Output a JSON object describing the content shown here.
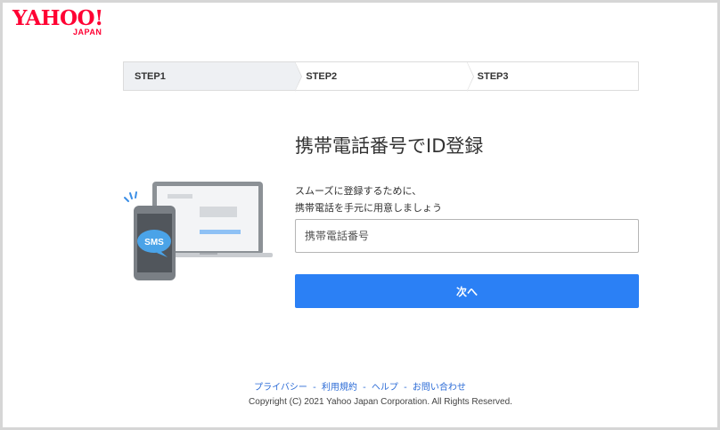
{
  "logo": {
    "main": "YAHOO!",
    "sub": "JAPAN"
  },
  "steps": [
    {
      "label": "STEP1",
      "active": true
    },
    {
      "label": "STEP2",
      "active": false
    },
    {
      "label": "STEP3",
      "active": false
    }
  ],
  "main": {
    "title": "携帯電話番号でID登録",
    "desc_line1": "スムーズに登録するために、",
    "desc_line2": "携帯電話を手元に用意しましょう",
    "phone_placeholder": "携帯電話番号",
    "next_label": "次へ"
  },
  "illustration": {
    "badge": "SMS"
  },
  "footer": {
    "links": [
      {
        "label": "プライバシー"
      },
      {
        "label": "利用規約"
      },
      {
        "label": "ヘルプ"
      },
      {
        "label": "お問い合わせ"
      }
    ],
    "separator": "-",
    "copyright": "Copyright (C) 2021 Yahoo Japan Corporation. All Rights Reserved."
  },
  "colors": {
    "brand": "#ff0033",
    "primary_button": "#2b80f5",
    "link": "#2b6bd6",
    "active_step_bg": "#eef0f3"
  }
}
